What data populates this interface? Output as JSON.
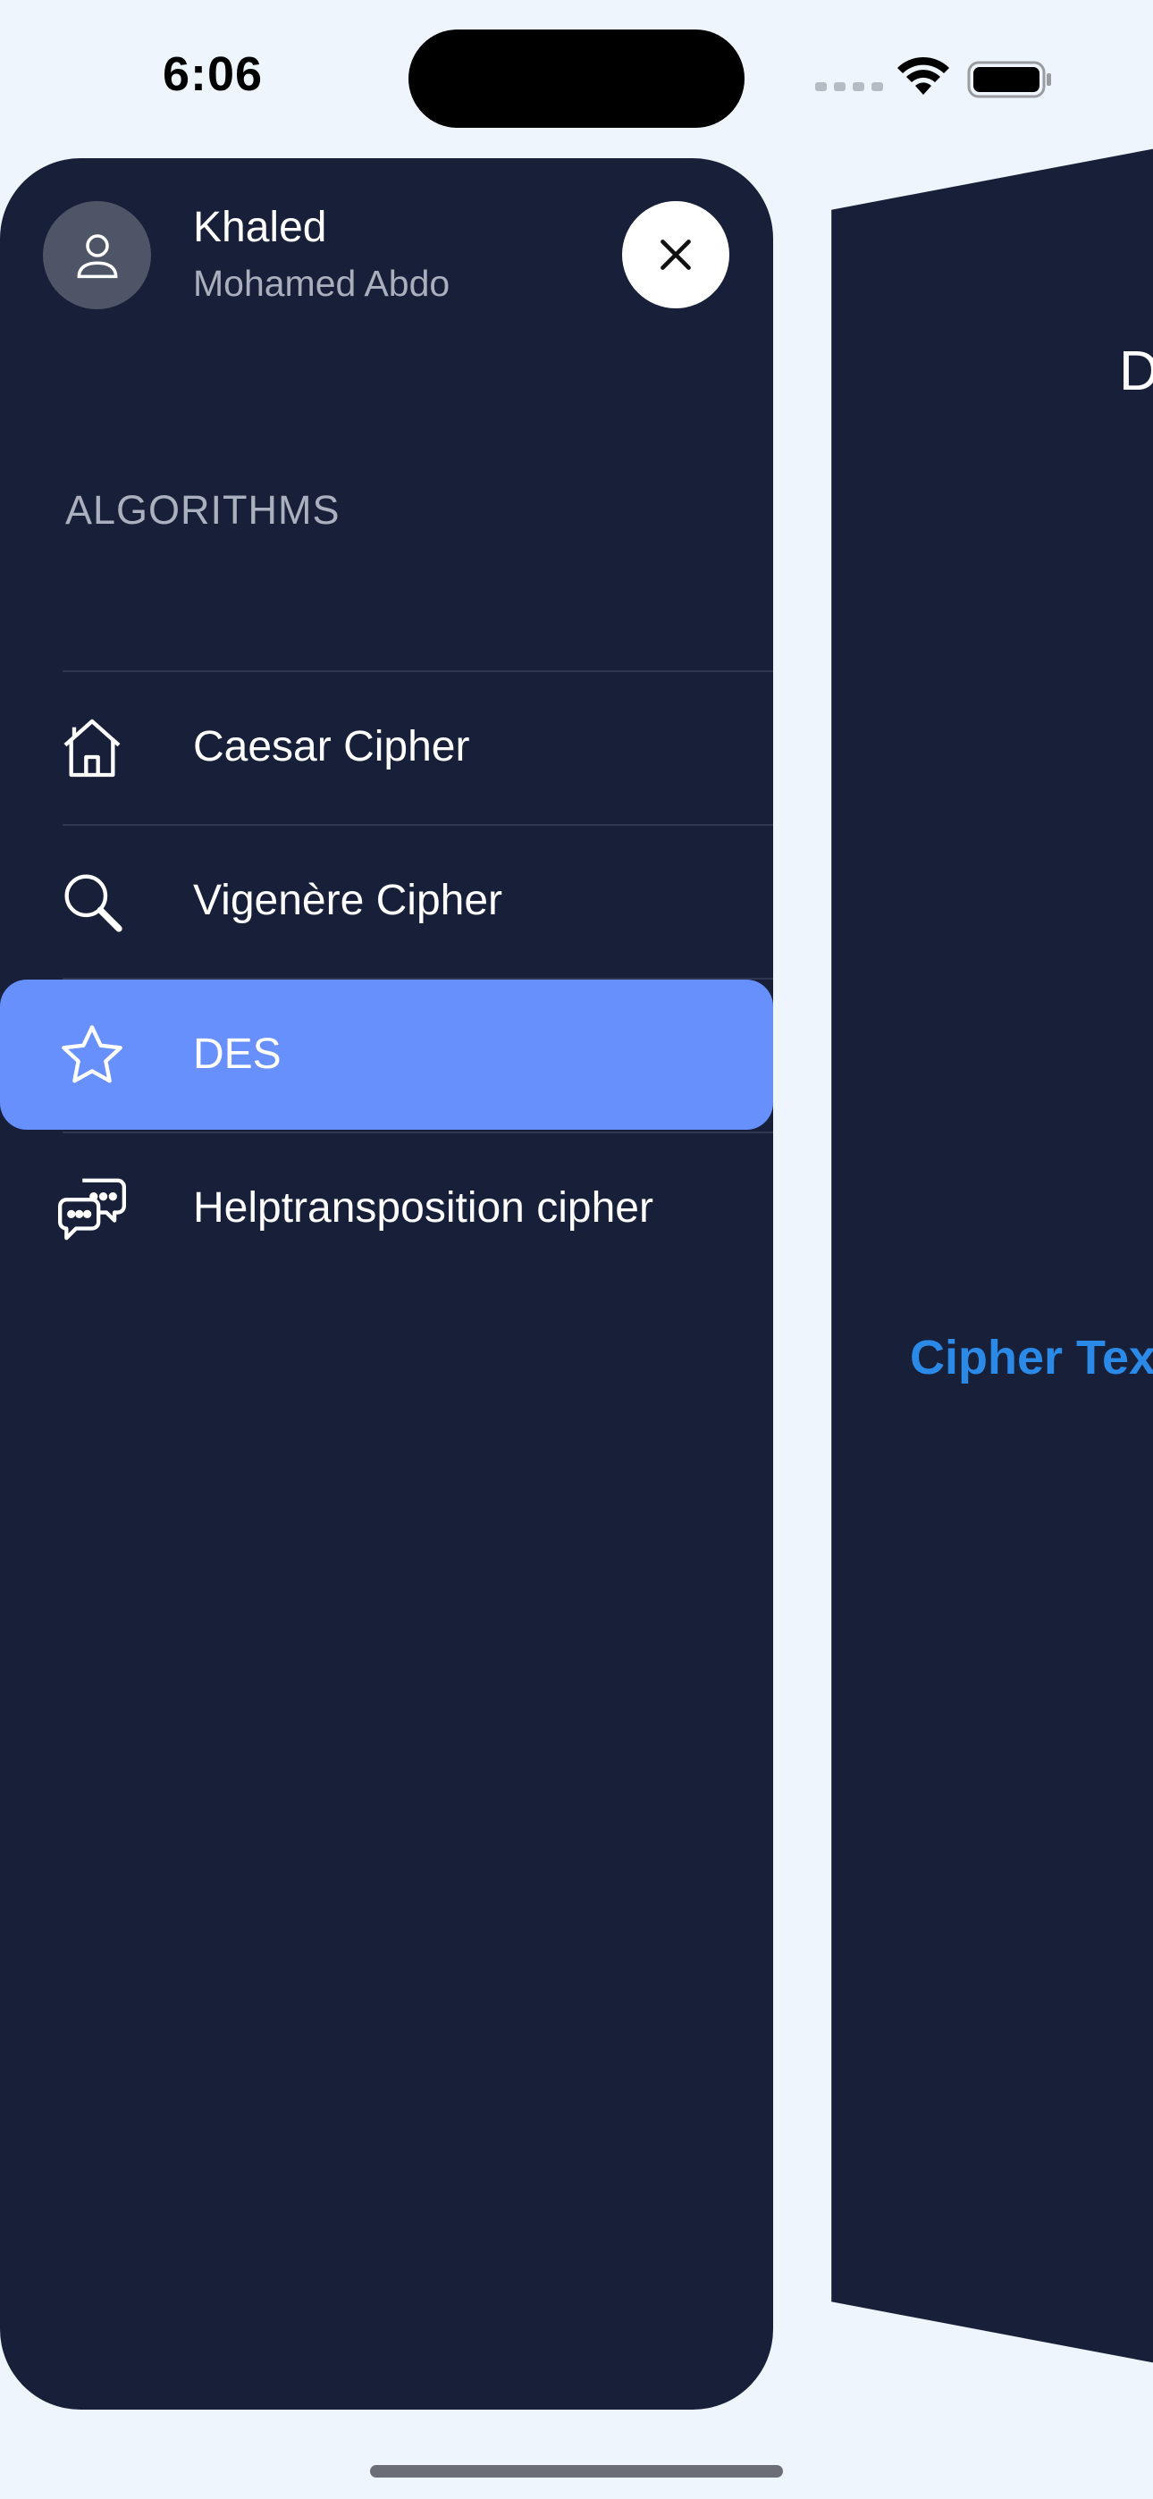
{
  "status_bar": {
    "time": "6:06"
  },
  "drawer": {
    "user": {
      "first_name": "Khaled",
      "last_name": "Mohamed Abdo",
      "avatar_icon": "person-icon"
    },
    "close_icon": "close-icon",
    "section_title": "ALGORITHMS",
    "items": [
      {
        "label": "Caesar Cipher",
        "icon": "home-icon",
        "active": false
      },
      {
        "label": "Vigenère Cipher",
        "icon": "search-icon",
        "active": false
      },
      {
        "label": "DES",
        "icon": "star-icon",
        "active": true
      },
      {
        "label": "Helptransposition cipher",
        "icon": "chat-bubbles-icon",
        "active": false
      }
    ]
  },
  "page": {
    "title_partial": "D",
    "link_partial": "Cipher Tex"
  },
  "colors": {
    "drawer_bg": "#182039",
    "active_item": "#6790fd",
    "accent_link": "#2b8ae8",
    "screen_bg": "#eef5fd"
  }
}
